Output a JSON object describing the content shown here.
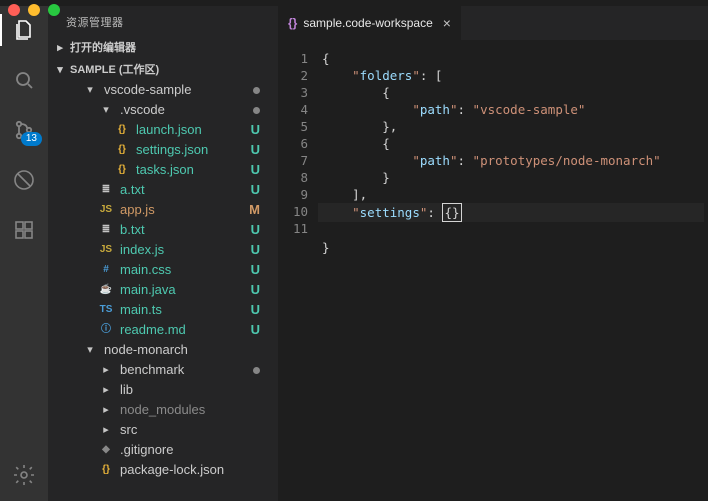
{
  "traffic": {
    "r": "",
    "y": "",
    "g": ""
  },
  "activitybar": {
    "explorer": "files-icon",
    "search": "search-icon",
    "scm": "scm-icon",
    "scm_badge": "13",
    "debug": "bug-icon",
    "extensions": "extensions-icon",
    "settings": "gear-icon"
  },
  "sidebar": {
    "title": "资源管理器",
    "sections": {
      "openEditors": "打开的编辑器",
      "sampleWorkspace": "SAMPLE (工作区)"
    },
    "tree": [
      {
        "kind": "folder",
        "depth": 1,
        "open": true,
        "label": "vscode-sample",
        "dot": true
      },
      {
        "kind": "folder",
        "depth": 2,
        "open": true,
        "label": ".vscode",
        "dot": true
      },
      {
        "kind": "file",
        "depth": 3,
        "icon": "{}",
        "iconColor": "#e8b339",
        "label": "launch.json",
        "status": "U",
        "statusColor": "#4ec9b0"
      },
      {
        "kind": "file",
        "depth": 3,
        "icon": "{}",
        "iconColor": "#e8b339",
        "label": "settings.json",
        "status": "U",
        "statusColor": "#4ec9b0"
      },
      {
        "kind": "file",
        "depth": 3,
        "icon": "{}",
        "iconColor": "#e8b339",
        "label": "tasks.json",
        "status": "U",
        "statusColor": "#4ec9b0"
      },
      {
        "kind": "file",
        "depth": 2,
        "icon": "≣",
        "iconColor": "#c5c5c5",
        "label": "a.txt",
        "status": "U",
        "statusColor": "#4ec9b0"
      },
      {
        "kind": "file",
        "depth": 2,
        "icon": "JS",
        "iconColor": "#c7a93c",
        "label": "app.js",
        "status": "M",
        "statusColor": "#d19a66"
      },
      {
        "kind": "file",
        "depth": 2,
        "icon": "≣",
        "iconColor": "#c5c5c5",
        "label": "b.txt",
        "status": "U",
        "statusColor": "#4ec9b0"
      },
      {
        "kind": "file",
        "depth": 2,
        "icon": "JS",
        "iconColor": "#c7a93c",
        "label": "index.js",
        "status": "U",
        "statusColor": "#4ec9b0"
      },
      {
        "kind": "file",
        "depth": 2,
        "icon": "#",
        "iconColor": "#4a9cd6",
        "label": "main.css",
        "status": "U",
        "statusColor": "#4ec9b0"
      },
      {
        "kind": "file",
        "depth": 2,
        "icon": "☕",
        "iconColor": "#c0392b",
        "label": "main.java",
        "status": "U",
        "statusColor": "#4ec9b0"
      },
      {
        "kind": "file",
        "depth": 2,
        "icon": "TS",
        "iconColor": "#4a9cd6",
        "label": "main.ts",
        "status": "U",
        "statusColor": "#4ec9b0"
      },
      {
        "kind": "file",
        "depth": 2,
        "icon": "ⓘ",
        "iconColor": "#4a9cd6",
        "label": "readme.md",
        "status": "U",
        "statusColor": "#4ec9b0"
      },
      {
        "kind": "folder",
        "depth": 1,
        "open": true,
        "label": "node-monarch"
      },
      {
        "kind": "folder",
        "depth": 2,
        "open": false,
        "label": "benchmark",
        "dot": true
      },
      {
        "kind": "folder",
        "depth": 2,
        "open": false,
        "label": "lib"
      },
      {
        "kind": "folder",
        "depth": 2,
        "open": false,
        "label": "node_modules",
        "muted": true
      },
      {
        "kind": "folder",
        "depth": 2,
        "open": false,
        "label": "src"
      },
      {
        "kind": "file",
        "depth": 2,
        "icon": "◆",
        "iconColor": "#888888",
        "label": ".gitignore"
      },
      {
        "kind": "file",
        "depth": 2,
        "icon": "{}",
        "iconColor": "#e8b339",
        "label": "package-lock.json"
      }
    ]
  },
  "editor": {
    "tab": {
      "icon": "{}",
      "label": "sample.code-workspace"
    },
    "lines": [
      "1",
      "2",
      "3",
      "4",
      "5",
      "6",
      "7",
      "8",
      "9",
      "10",
      "11"
    ],
    "code": {
      "folders_key": "folders",
      "path_key": "path",
      "path_val_1": "vscode-sample",
      "path_val_2": "prototypes/node-monarch",
      "settings_key": "settings",
      "brace_open": "{",
      "brace_close": "}",
      "bracket_open": "[",
      "bracket_close": "]",
      "comma": ",",
      "quot": "\"",
      "colon": ": "
    }
  }
}
